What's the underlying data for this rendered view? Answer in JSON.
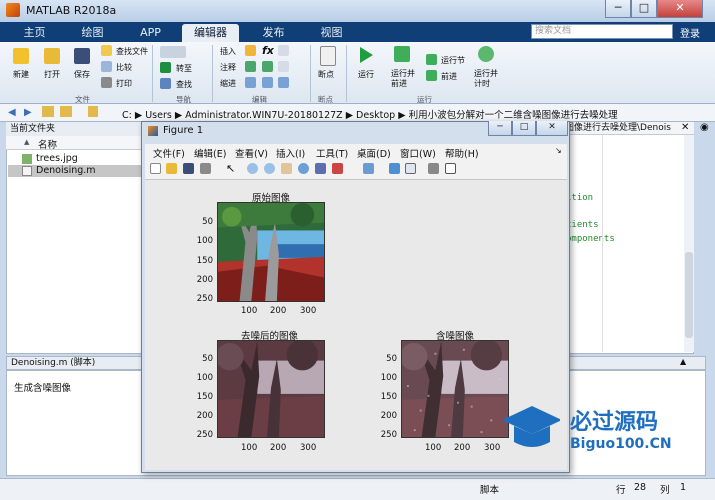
{
  "window": {
    "title": "MATLAB R2018a",
    "min": "─",
    "max": "□",
    "close": "✕"
  },
  "tabs": [
    {
      "label": "主页"
    },
    {
      "label": "绘图"
    },
    {
      "label": "APP"
    },
    {
      "label": "编辑器"
    },
    {
      "label": "发布"
    },
    {
      "label": "视图"
    }
  ],
  "search_placeholder": "搜索文档",
  "login_label": "登录",
  "ribbon": {
    "file_group": "文件",
    "new_label": "新建",
    "open_label": "打开",
    "save_label": "保存",
    "find_file": "查找文件",
    "compare": "比较",
    "print": "打印",
    "nav_group": "导航",
    "goto": "转至",
    "find": "查找",
    "edit_group": "编辑",
    "insert": "插入",
    "comment": "注释",
    "indent": "缩进",
    "fx": "fx",
    "bp_group": "断点",
    "breakpoints": "断点",
    "run_group": "运行",
    "run": "运行",
    "run_advance": "运行并\n前进",
    "run_section": "运行节",
    "advance": "前进",
    "run_time": "运行并\n计时"
  },
  "path": [
    "C:",
    "Users",
    "Administrator.WIN7U-20180127Z",
    "Desktop",
    "利用小波包分解对一个二维含噪图像进行去噪处理"
  ],
  "path_tail": "图像进行去噪处理\\Denois",
  "current_folder": {
    "header": "当前文件夹",
    "col_name": "名称",
    "sort_icon": "▲",
    "files": [
      "trees.jpg",
      "Denoising.m"
    ]
  },
  "detail": {
    "header": "Denoising.m  (脚本)",
    "text": "生成含噪图像"
  },
  "editor_code": [
    "ition",
    "cients",
    "omponents"
  ],
  "status": {
    "script": "脚本",
    "row_label": "行",
    "row": "28",
    "col_label": "列",
    "col": "1"
  },
  "figure": {
    "title": "Figure 1",
    "menu": [
      "文件(F)",
      "编辑(E)",
      "查看(V)",
      "插入(I)",
      "工具(T)",
      "桌面(D)",
      "窗口(W)",
      "帮助(H)"
    ],
    "plots": [
      {
        "title": "原始图像",
        "yticks": [
          "50",
          "100",
          "150",
          "200",
          "250"
        ],
        "xticks": [
          "100",
          "200",
          "300"
        ]
      },
      {
        "title": "去噪后的图像",
        "yticks": [
          "50",
          "100",
          "150",
          "200",
          "250"
        ],
        "xticks": [
          "100",
          "200",
          "300"
        ]
      },
      {
        "title": "含噪图像",
        "yticks": [
          "50",
          "100",
          "150",
          "200",
          "250"
        ],
        "xticks": [
          "100",
          "200",
          "300"
        ]
      }
    ]
  },
  "watermark": {
    "cn": "必过源码",
    "en": "Biguo100.CN"
  },
  "colors": {
    "tabbar": "#0f3f76",
    "accent": "#1f5fa8",
    "code_green": "#238a2f"
  }
}
